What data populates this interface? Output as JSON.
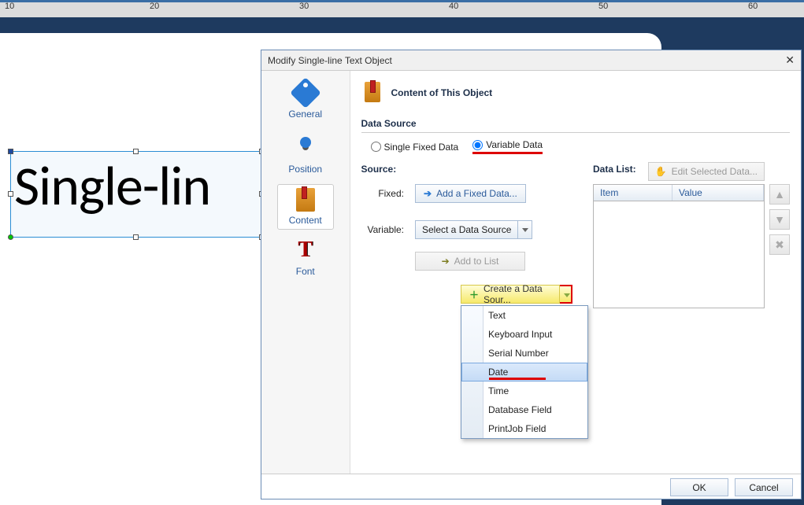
{
  "ruler": {
    "labels": [
      "10",
      "20",
      "30",
      "40",
      "50",
      "60"
    ]
  },
  "canvasText": "Single-lin",
  "dialog": {
    "title": "Modify Single-line Text Object",
    "tabs": {
      "general": "General",
      "position": "Position",
      "content": "Content",
      "font": "Font"
    },
    "headerTitle": "Content of This Object",
    "sectionTitle": "Data Source",
    "radios": {
      "single": "Single Fixed Data",
      "variable": "Variable Data"
    },
    "sourceLabel": "Source:",
    "fixedLabel": "Fixed:",
    "variableLabel": "Variable:",
    "addFixedBtn": "Add a Fixed Data...",
    "selectSource": "Select a Data Source",
    "addToList": "Add to List",
    "createSource": "Create a Data Sour...",
    "dropdownItems": [
      "Text",
      "Keyboard Input",
      "Serial Number",
      "Date",
      "Time",
      "Database Field",
      "PrintJob Field"
    ],
    "dataListLabel": "Data List:",
    "editSelected": "Edit Selected Data...",
    "cols": {
      "item": "Item",
      "value": "Value"
    },
    "ok": "OK",
    "cancel": "Cancel"
  }
}
